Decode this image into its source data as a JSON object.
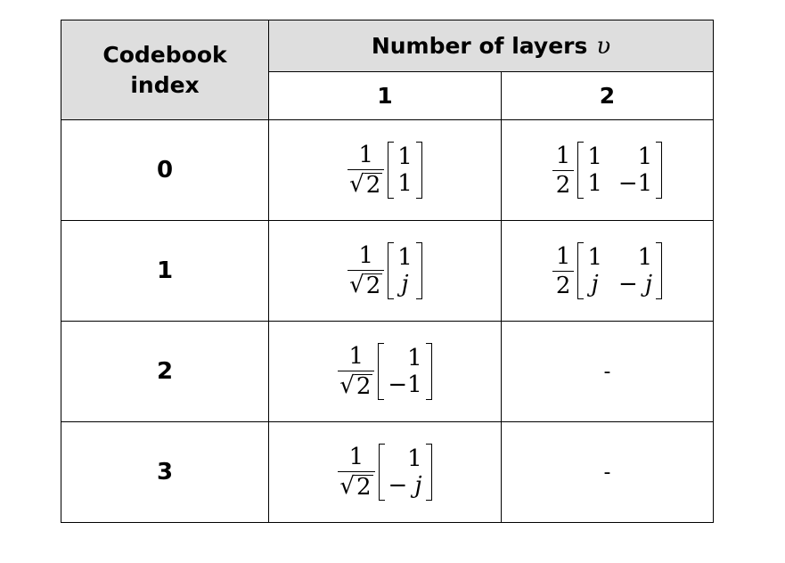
{
  "header": {
    "index_label_line1": "Codebook",
    "index_label_line2": "index",
    "layers_label": "Number of layers",
    "layers_symbol": "υ",
    "layer_1": "1",
    "layer_2": "2"
  },
  "rows": [
    {
      "index": "0",
      "one_layer": {
        "scalar_num": "1",
        "scalar_den": "2",
        "scalar_den_sqrt": true,
        "matrix": [
          [
            "1"
          ],
          [
            "1"
          ]
        ]
      },
      "two_layers": {
        "scalar_num": "1",
        "scalar_den": "2",
        "matrix": [
          [
            "1",
            "1"
          ],
          [
            "1",
            "−1"
          ]
        ]
      }
    },
    {
      "index": "1",
      "one_layer": {
        "scalar_num": "1",
        "scalar_den": "2",
        "scalar_den_sqrt": true,
        "matrix": [
          [
            "1"
          ],
          [
            "j"
          ]
        ]
      },
      "two_layers": {
        "scalar_num": "1",
        "scalar_den": "2",
        "matrix": [
          [
            "1",
            "1"
          ],
          [
            "j",
            "− j"
          ]
        ]
      }
    },
    {
      "index": "2",
      "one_layer": {
        "scalar_num": "1",
        "scalar_den": "2",
        "scalar_den_sqrt": true,
        "matrix": [
          [
            "1"
          ],
          [
            "−1"
          ]
        ]
      },
      "two_layers_text": "-"
    },
    {
      "index": "3",
      "one_layer": {
        "scalar_num": "1",
        "scalar_den": "2",
        "scalar_den_sqrt": true,
        "matrix": [
          [
            "1"
          ],
          [
            "− j"
          ]
        ]
      },
      "two_layers_text": "-"
    }
  ]
}
